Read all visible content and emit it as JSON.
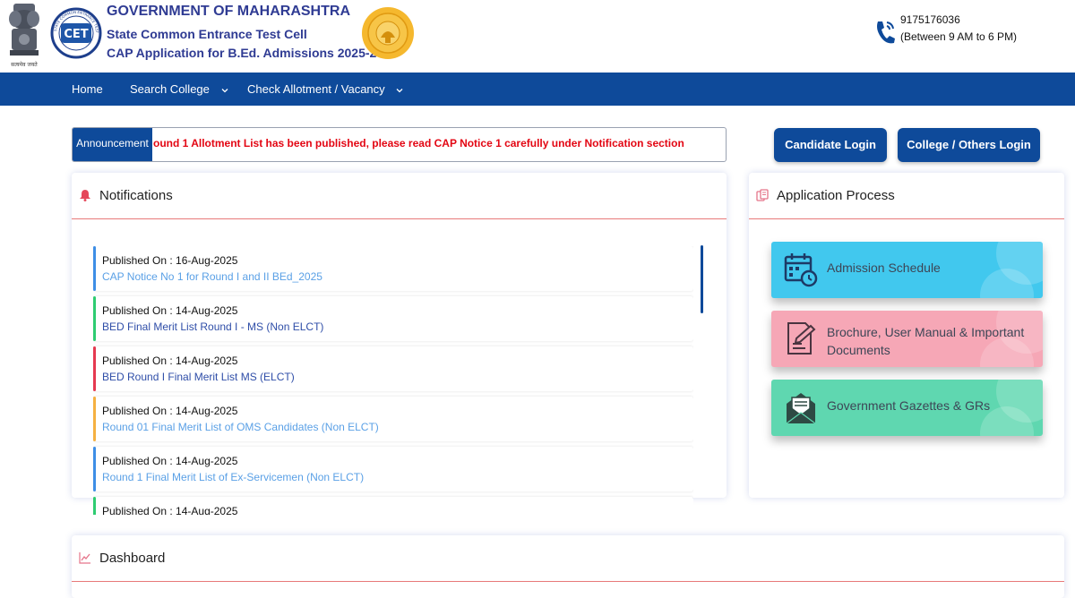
{
  "header": {
    "emblem_motto": "सत्यमेव जयते",
    "cet_logo_text": "CET",
    "cet_ring_text": "STATE COMMON ENTRANCE TEST CELL • MAHARASHTRA",
    "title_line1": "GOVERNMENT OF MAHARASHTRA",
    "title_line2": "State Common Entrance Test Cell",
    "title_line3": "CAP Application for B.Ed. Admissions 2025-26",
    "helpline_number": "9175176036",
    "helpline_hours": "(Between 9 AM to 6 PM)"
  },
  "nav": {
    "home": "Home",
    "search_college": "Search College",
    "check_allotment": "Check Allotment / Vacancy"
  },
  "announcement": {
    "label": "Announcement",
    "text": "ound 1 Allotment List has been published, please read CAP Notice 1 carefully under Notification section"
  },
  "login": {
    "candidate": "Candidate Login",
    "college": "College / Others Login"
  },
  "notifications": {
    "title": "Notifications",
    "items": [
      {
        "published": "Published On : 16-Aug-2025",
        "title": "CAP Notice No 1 for Round I and II BEd_2025",
        "bar_color": "#3e8ee6",
        "title_color": "#5aa0e6"
      },
      {
        "published": "Published On : 14-Aug-2025",
        "title": "BED Final Merit List Round I - MS (Non ELCT)",
        "bar_color": "#2ecc71",
        "title_color": "#2f4ea8"
      },
      {
        "published": "Published On : 14-Aug-2025",
        "title": "BED Round I Final Merit List MS (ELCT)",
        "bar_color": "#e53950",
        "title_color": "#2f4ea8"
      },
      {
        "published": "Published On : 14-Aug-2025",
        "title": "Round 01 Final Merit List of OMS Candidates (Non ELCT)",
        "bar_color": "#f5b041",
        "title_color": "#5aa0e6"
      },
      {
        "published": "Published On : 14-Aug-2025",
        "title": "Round 1 Final Merit List of Ex-Servicemen (Non ELCT)",
        "bar_color": "#3e8ee6",
        "title_color": "#5aa0e6"
      },
      {
        "published": "Published On : 14-Aug-2025",
        "title": "",
        "bar_color": "#2ecc71",
        "title_color": "#5aa0e6"
      }
    ]
  },
  "process": {
    "title": "Application Process",
    "items": [
      {
        "label": "Admission Schedule",
        "bg": "#41c8ee"
      },
      {
        "label": "Brochure, User Manual & Important Documents",
        "bg": "#f6a7b6"
      },
      {
        "label": "Government Gazettes & GRs",
        "bg": "#5fd7b0"
      }
    ]
  },
  "dashboard": {
    "title": "Dashboard"
  },
  "colors": {
    "primary": "#0e4a9a",
    "announcement_text": "#e30613",
    "header_title": "#2f3b93"
  }
}
